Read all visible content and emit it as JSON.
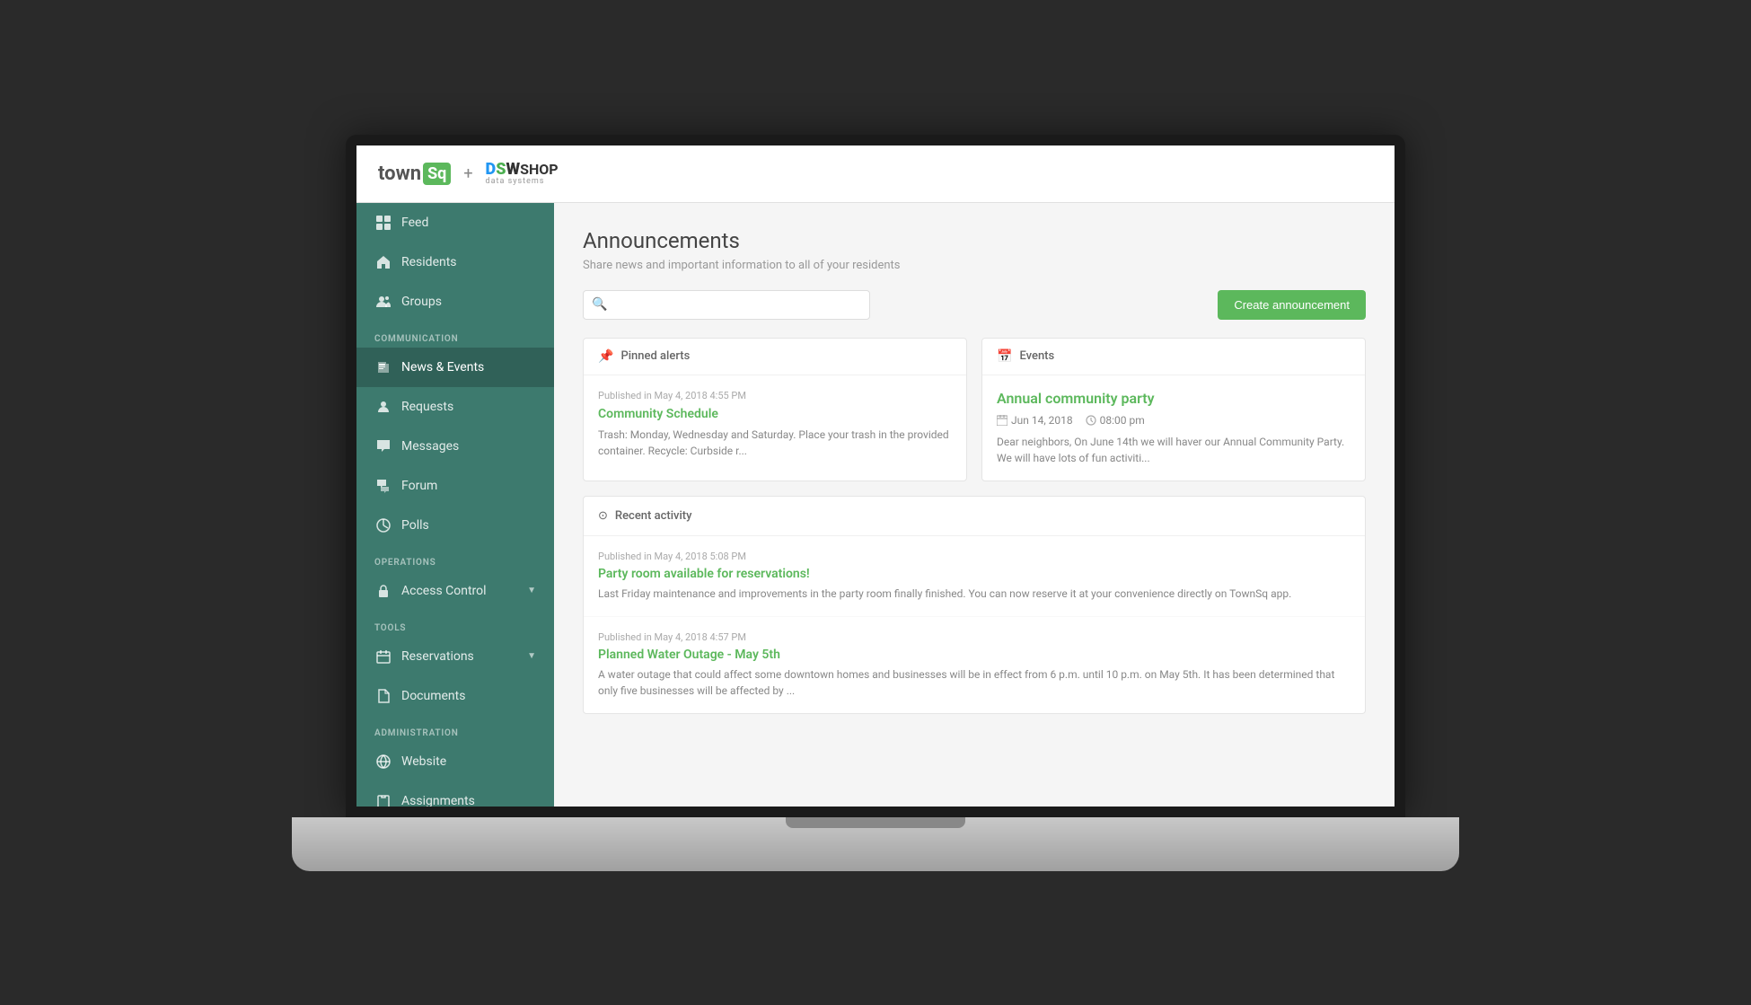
{
  "app": {
    "title": "TownSq + DSWShop",
    "logo_text": "town",
    "logo_sq": "Sq",
    "logo_plus": "+",
    "logo_dsw": "DSW",
    "logo_shop": "SHOP",
    "logo_data": "data systems"
  },
  "sidebar": {
    "main_items": [
      {
        "id": "feed",
        "label": "Feed",
        "icon": "grid"
      },
      {
        "id": "residents",
        "label": "Residents",
        "icon": "home"
      },
      {
        "id": "groups",
        "label": "Groups",
        "icon": "users"
      }
    ],
    "communication_label": "COMMUNICATION",
    "communication_items": [
      {
        "id": "news-events",
        "label": "News & Events",
        "icon": "newspaper",
        "active": true
      },
      {
        "id": "requests",
        "label": "Requests",
        "icon": "person"
      },
      {
        "id": "messages",
        "label": "Messages",
        "icon": "chat"
      },
      {
        "id": "forum",
        "label": "Forum",
        "icon": "forum"
      },
      {
        "id": "polls",
        "label": "Polls",
        "icon": "poll"
      }
    ],
    "operations_label": "OPERATIONS",
    "operations_items": [
      {
        "id": "access-control",
        "label": "Access Control",
        "icon": "lock",
        "has_chevron": true
      }
    ],
    "tools_label": "TOOLS",
    "tools_items": [
      {
        "id": "reservations",
        "label": "Reservations",
        "icon": "calendar",
        "has_chevron": true
      },
      {
        "id": "documents",
        "label": "Documents",
        "icon": "document"
      }
    ],
    "administration_label": "ADMINISTRATION",
    "administration_items": [
      {
        "id": "website",
        "label": "Website",
        "icon": "globe"
      },
      {
        "id": "assignments",
        "label": "Assignments",
        "icon": "clipboard"
      }
    ]
  },
  "page": {
    "title": "Announcements",
    "subtitle": "Share news and important information to all of your residents",
    "search_placeholder": "",
    "create_btn": "Create announcement"
  },
  "pinned_alerts": {
    "header": "Pinned alerts",
    "meta": "Published in May 4, 2018 4:55 PM",
    "title": "Community Schedule",
    "text": "Trash: Monday, Wednesday and Saturday. Place your trash in the provided container. Recycle: Curbside r..."
  },
  "events": {
    "header": "Events",
    "title": "Annual community party",
    "date": "Jun 14, 2018",
    "time": "08:00 pm",
    "text": "Dear neighbors, On June 14th we will haver our Annual Community Party. We will have lots of fun activiti..."
  },
  "recent_activity": {
    "header": "Recent activity",
    "items": [
      {
        "meta": "Published in May 4, 2018 5:08 PM",
        "title": "Party room available for reservations!",
        "text": "Last Friday maintenance and improvements in the party room finally finished. You can now reserve it at your convenience directly on TownSq app."
      },
      {
        "meta": "Published in May 4, 2018 4:57 PM",
        "title": "Planned Water Outage - May 5th",
        "text": "A water outage that could affect some downtown homes and businesses will be in effect from 6 p.m. until 10 p.m. on May 5th. It has been determined that only five businesses will be affected by ..."
      }
    ]
  }
}
